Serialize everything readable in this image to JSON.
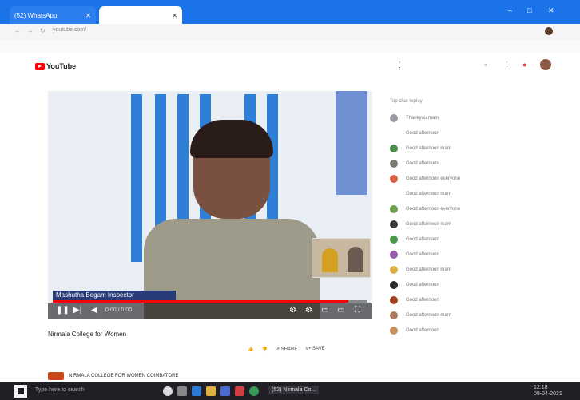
{
  "browser": {
    "tab1_title": "(52) WhatsApp",
    "tab2_title": "",
    "url": "youtube.com/"
  },
  "youtube": {
    "logo_text": "YouTube"
  },
  "video": {
    "caption": "Mashutha Begam Inspector",
    "progress_fraction": 0.94,
    "title": "Nirmala College for Women",
    "time_display": "0:00 / 0:00"
  },
  "below_video": {
    "meta": "",
    "like_label": "",
    "share_label": "SHARE",
    "save_label": "SAVE"
  },
  "channel": {
    "name": "NIRMALA COLLEGE FOR WOMEN COIMBATORE"
  },
  "live_chat": {
    "header": "Top chat replay",
    "messages": [
      {
        "color": "#9a9aa0",
        "text": "Thankyou mam"
      },
      {
        "color": "#ffffff",
        "text": "Good afternoon"
      },
      {
        "color": "#4a8c4a",
        "text": "Good afternoon mam"
      },
      {
        "color": "#7a7a70",
        "text": "Good afternoon"
      },
      {
        "color": "#d86040",
        "text": "Good afternoon everyone"
      },
      {
        "color": "#ffffff",
        "text": "Good afternoon mam"
      },
      {
        "color": "#6aa04a",
        "text": "Good afternoon everyone"
      },
      {
        "color": "#3a3a3a",
        "text": "Good afternoon mam"
      },
      {
        "color": "#4a9a4a",
        "text": "Good afternoon"
      },
      {
        "color": "#9a5ab0",
        "text": "Good afternoon"
      },
      {
        "color": "#e0b040",
        "text": "Good afternoon mam"
      },
      {
        "color": "#2a2a2a",
        "text": "Good afternoon"
      },
      {
        "color": "#a04020",
        "text": "Good afternoon"
      },
      {
        "color": "#b07a60",
        "text": "Good afternoon mam"
      },
      {
        "color": "#c8905a",
        "text": "Good afternoon"
      }
    ]
  },
  "taskbar": {
    "search_placeholder": "Type here to search",
    "active_item": "(52) Nirmala Co...",
    "time": "12:18",
    "date": "09-04-2021"
  }
}
